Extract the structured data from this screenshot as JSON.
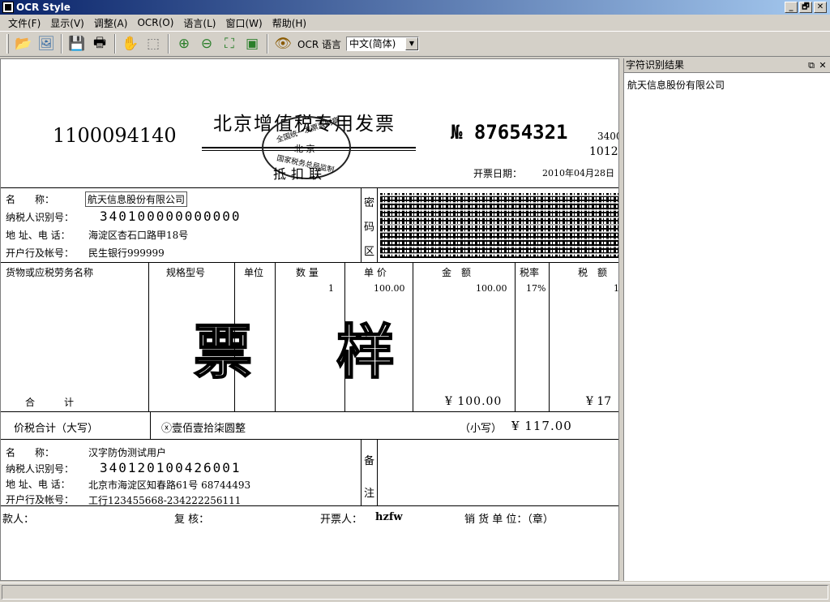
{
  "window": {
    "title": "OCR Style",
    "min": "_",
    "restore": "🗗",
    "close": "✕"
  },
  "menu": [
    "文件(F)",
    "显示(V)",
    "调整(A)",
    "OCR(O)",
    "语言(L)",
    "窗口(W)",
    "帮助(H)"
  ],
  "toolbar": {
    "icons": [
      "folder-open-icon",
      "scan-icon",
      "save-icon",
      "print-icon",
      "hand-icon",
      "select-icon",
      "zoom-in-icon",
      "zoom-out-icon",
      "fit-page-icon",
      "image-icon",
      "eye-icon"
    ],
    "ocr_language_label": "OCR 语言",
    "language_selected": "中文(简体)"
  },
  "result_panel": {
    "title": "字符识别结果",
    "text": "航天信息股份有限公司"
  },
  "invoice": {
    "code": "1100094140",
    "title": "北京增值税专用发票",
    "seal_line1": "全国统一发票监制章",
    "seal_line2": "北   京",
    "seal_line3": "国家税务总局监制",
    "copy_label": "抵扣联",
    "number": "№ 87654321",
    "side_num1": "3400",
    "side_num2": "1012",
    "date_label": "开票日期：",
    "date": "2010年04月28日",
    "buyer": {
      "name_label": "名　　称：",
      "name": "航天信息股份有限公司",
      "taxid_label": "纳税人识别号：",
      "taxid": "340100000000000",
      "addr_label": "地 址、电 话：",
      "addr": "海淀区杏石口路甲18号",
      "bank_label": "开户行及帐号：",
      "bank": "民生银行999999"
    },
    "cipher_label": [
      "密",
      "码",
      "区"
    ],
    "columns": [
      "货物或应税劳务名称",
      "规格型号",
      "单位",
      "数 量",
      "单 价",
      "金　额",
      "税率",
      "税　额"
    ],
    "row": {
      "qty": "1",
      "price": "100.00",
      "amount": "100.00",
      "rate": "17%",
      "tax": "1"
    },
    "stamp": [
      "票",
      "样"
    ],
    "total_label": "合　　　计",
    "total_amount": "¥ 100.00",
    "total_tax": "¥ 17",
    "sum_label": "价税合计（大写）",
    "sum_big": "ⓧ壹佰壹拾柒圆整",
    "sum_small_label": "（小写）",
    "sum_small": "¥ 117.00",
    "seller": {
      "name_label": "名　　称：",
      "name": "汉字防伪测试用户",
      "taxid_label": "纳税人识别号：",
      "taxid": "340120100426001",
      "addr_label": "地 址、电 话：",
      "addr": "北京市海淀区知春路61号 68744493",
      "bank_label": "开户行及帐号：",
      "bank": "工行123455668-234222256111"
    },
    "remark_label": [
      "备",
      "注"
    ],
    "footer": {
      "payee_label": "款人：",
      "review_label": "复 核：",
      "drawer_label": "开票人：",
      "drawer": "hzfw",
      "seller_label": "销 货 单 位：（章）"
    }
  }
}
